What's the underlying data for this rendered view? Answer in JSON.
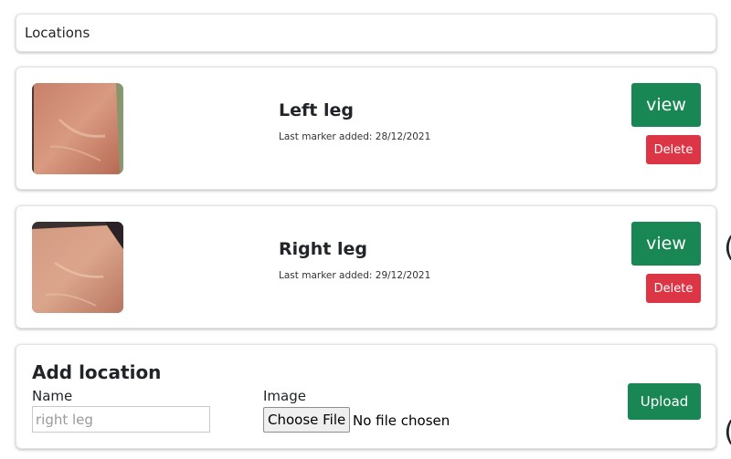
{
  "header": {
    "title": "Locations"
  },
  "locations": [
    {
      "name": "Left leg",
      "meta": "Last marker added: 28/12/2021",
      "view_label": "view",
      "delete_label": "Delete"
    },
    {
      "name": "Right leg",
      "meta": "Last marker added: 29/12/2021",
      "view_label": "view",
      "delete_label": "Delete"
    }
  ],
  "add_form": {
    "title": "Add location",
    "name_label": "Name",
    "name_placeholder": "right leg",
    "image_label": "Image",
    "choose_file_label": "Choose File",
    "no_file_text": "No file chosen",
    "upload_label": "Upload"
  },
  "colors": {
    "success": "#198754",
    "danger": "#dc3545",
    "card_border": "#e3e3e3"
  }
}
